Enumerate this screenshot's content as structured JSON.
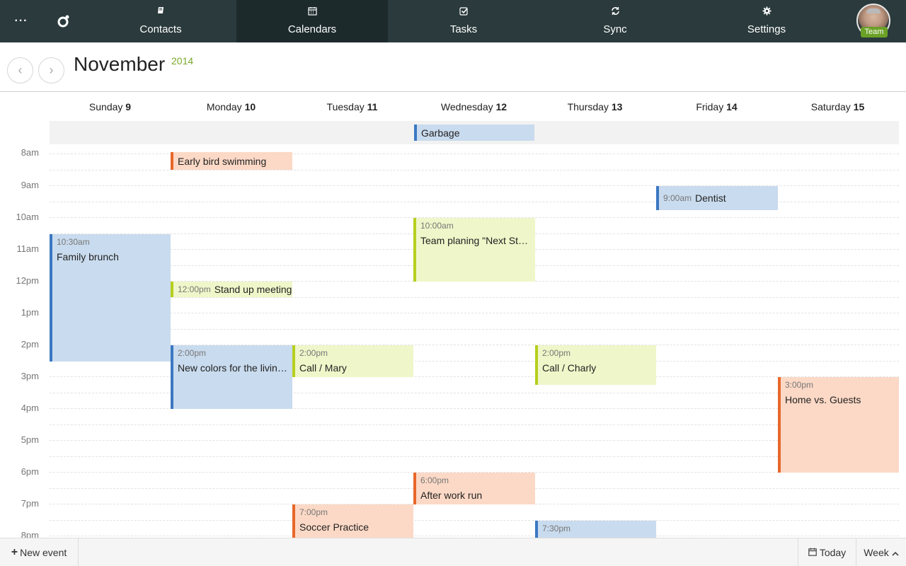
{
  "nav": {
    "more_label": "···",
    "tabs": [
      {
        "label": "Contacts",
        "icon": "book-icon"
      },
      {
        "label": "Calendars",
        "icon": "calendar-icon",
        "active": true
      },
      {
        "label": "Tasks",
        "icon": "checkbox-icon"
      },
      {
        "label": "Sync",
        "icon": "sync-icon"
      },
      {
        "label": "Settings",
        "icon": "gear-icon"
      }
    ],
    "badge": "Team"
  },
  "header": {
    "month": "November",
    "year": "2014",
    "prev_icon": "‹",
    "next_icon": "›"
  },
  "days": [
    {
      "name": "Sunday",
      "num": "9"
    },
    {
      "name": "Monday",
      "num": "10"
    },
    {
      "name": "Tuesday",
      "num": "11"
    },
    {
      "name": "Wednesday",
      "num": "12"
    },
    {
      "name": "Thursday",
      "num": "13"
    },
    {
      "name": "Friday",
      "num": "14"
    },
    {
      "name": "Saturday",
      "num": "15"
    }
  ],
  "hours": [
    "8am",
    "9am",
    "10am",
    "11am",
    "12pm",
    "1pm",
    "2pm",
    "3pm",
    "4pm",
    "5pm",
    "6pm",
    "7pm",
    "8pm"
  ],
  "allday_events": [
    {
      "title": "Garbage"
    }
  ],
  "events": [
    {
      "title": "Early bird swimming",
      "time": ""
    },
    {
      "title": "Dentist",
      "time": "9:00am"
    },
    {
      "title": "Team planing \"Next Steps\"",
      "time": "10:00am"
    },
    {
      "title": "Family brunch",
      "time": "10:30am"
    },
    {
      "title": "Stand up meeting",
      "time": "12:00pm"
    },
    {
      "title": "New colors for the living room",
      "time": "2:00pm"
    },
    {
      "title": "Call / Mary",
      "time": "2:00pm"
    },
    {
      "title": "Call / Charly",
      "time": "2:00pm"
    },
    {
      "title": "Home vs. Guests",
      "time": "3:00pm"
    },
    {
      "title": "After work run",
      "time": "6:00pm"
    },
    {
      "title": "Soccer Practice",
      "time": "7:00pm"
    },
    {
      "title": "",
      "time": "7:30pm"
    }
  ],
  "colors": {
    "nav_bg": "#2b3a3c",
    "nav_active": "#1d2a2c",
    "accent_green": "#7aa92b",
    "event_blue": "#c9dbee",
    "event_green": "#eff6c9",
    "event_orange": "#fcd9c6"
  },
  "bottom": {
    "new_event": "New event",
    "today": "Today",
    "view": "Week"
  }
}
